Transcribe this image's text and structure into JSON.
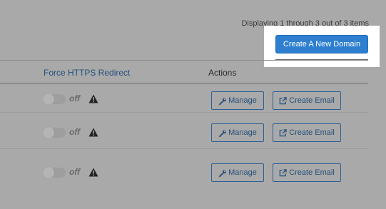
{
  "header": {
    "display_info": "Displaying 1 through 3 out of 3 items",
    "create_button_label": "Create A New Domain"
  },
  "table": {
    "columns": [
      "Force HTTPS Redirect",
      "Actions"
    ],
    "rows": [
      {
        "https_redirect": "off",
        "manage_label": "Manage",
        "email_label": "Create Email"
      },
      {
        "https_redirect": "off",
        "manage_label": "Manage",
        "email_label": "Create Email"
      },
      {
        "https_redirect": "off",
        "manage_label": "Manage",
        "email_label": "Create Email"
      }
    ]
  },
  "icons": {
    "warning": "warning-icon",
    "wrench": "wrench-icon",
    "external_link": "external-link-icon"
  },
  "colors": {
    "primary_button": "#2f7fd0",
    "link_text": "#25507e",
    "overlay_background": "#a9a9a9"
  }
}
